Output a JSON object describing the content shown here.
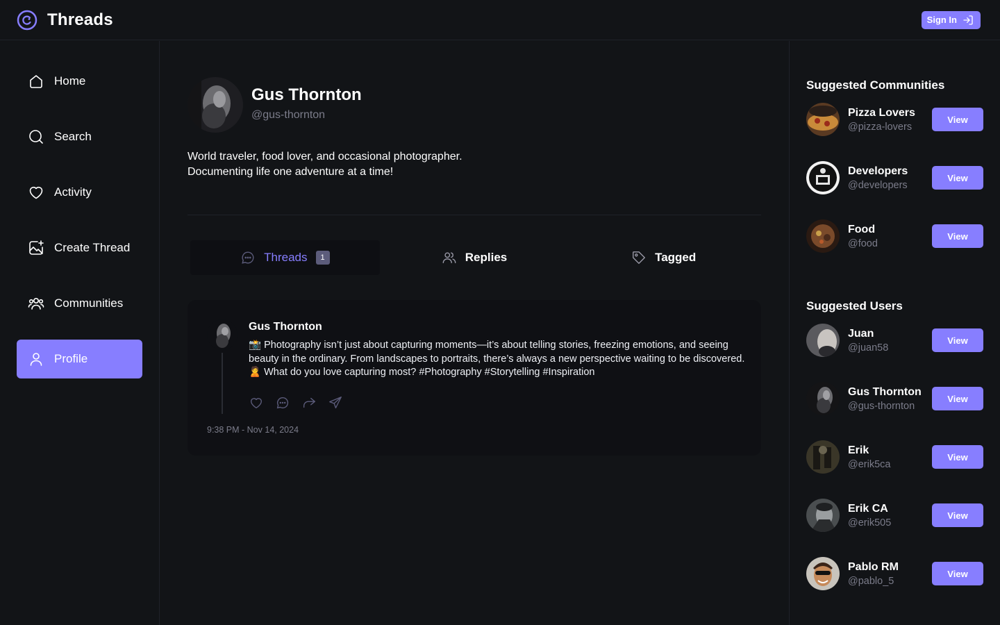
{
  "header": {
    "app_title": "Threads",
    "sign_in_label": "Sign In",
    "logo_icon": "threads-logo-icon"
  },
  "sidebar": {
    "items": [
      {
        "label": "Home",
        "icon": "home-icon",
        "active": false
      },
      {
        "label": "Search",
        "icon": "search-icon",
        "active": false
      },
      {
        "label": "Activity",
        "icon": "heart-icon",
        "active": false
      },
      {
        "label": "Create Thread",
        "icon": "image-plus-icon",
        "active": false
      },
      {
        "label": "Communities",
        "icon": "users-icon",
        "active": false
      },
      {
        "label": "Profile",
        "icon": "user-icon",
        "active": true
      }
    ]
  },
  "profile": {
    "name": "Gus Thornton",
    "handle": "@gus-thornton",
    "bio": "World traveler, food lover, and occasional photographer.\nDocumenting life one adventure at a time!"
  },
  "tabs": [
    {
      "label": "Threads",
      "icon": "chat-bubble-icon",
      "count": "1",
      "active": true
    },
    {
      "label": "Replies",
      "icon": "users-icon",
      "active": false
    },
    {
      "label": "Tagged",
      "icon": "tag-icon",
      "active": false
    }
  ],
  "thread": {
    "author": "Gus Thornton",
    "text": "📸 Photography isn’t just about capturing moments—it’s about telling stories, freezing emotions, and seeing beauty in the ordinary. From landscapes to portraits, there’s always a new perspective waiting to be discovered. 🙎 What do you love capturing most? #Photography #Storytelling #Inspiration",
    "timestamp": "9:38 PM - Nov 14, 2024",
    "actions": [
      "heart-icon",
      "reply-icon",
      "repost-icon",
      "share-icon"
    ]
  },
  "right_sidebar": {
    "communities_title": "Suggested Communities",
    "communities": [
      {
        "name": "Pizza Lovers",
        "handle": "@pizza-lovers",
        "button": "View"
      },
      {
        "name": "Developers",
        "handle": "@developers",
        "button": "View"
      },
      {
        "name": "Food",
        "handle": "@food",
        "button": "View"
      }
    ],
    "users_title": "Suggested Users",
    "users": [
      {
        "name": "Juan",
        "handle": "@juan58",
        "button": "View"
      },
      {
        "name": "Gus Thornton",
        "handle": "@gus-thornton",
        "button": "View"
      },
      {
        "name": "Erik",
        "handle": "@erik5ca",
        "button": "View"
      },
      {
        "name": "Erik CA",
        "handle": "@erik505",
        "button": "View"
      },
      {
        "name": "Pablo RM",
        "handle": "@pablo_5",
        "button": "View"
      }
    ]
  },
  "colors": {
    "accent": "#877eff",
    "background": "#121417",
    "card": "#0f1014",
    "muted": "#7b7c8a"
  }
}
